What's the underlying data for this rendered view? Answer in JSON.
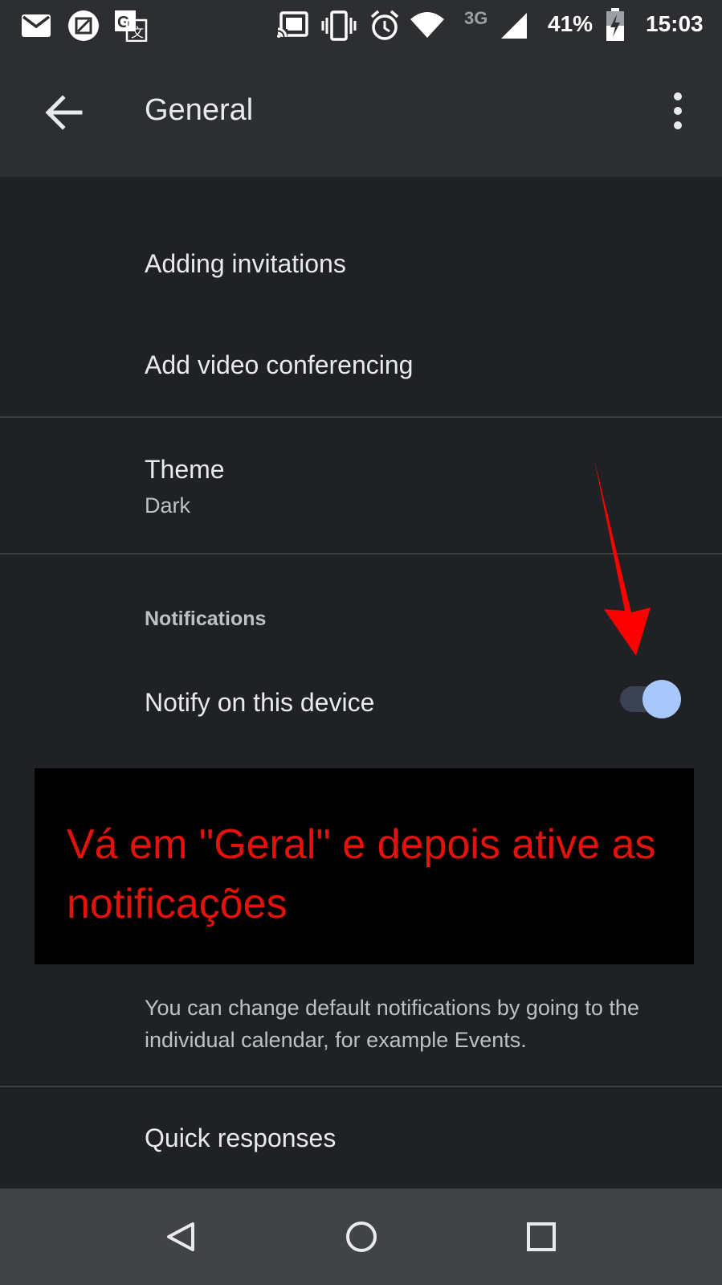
{
  "status_bar": {
    "network": "3G",
    "battery": "41%",
    "time": "15:03",
    "icons": [
      "mail-icon",
      "screenshot-icon",
      "translate-icon",
      "cast-icon",
      "vibrate-icon",
      "alarm-icon",
      "wifi-icon",
      "signal-icon",
      "battery-charging-icon"
    ]
  },
  "app_bar": {
    "title": "General",
    "back_icon": "arrow-back-icon",
    "menu_icon": "more-vert-icon"
  },
  "settings": {
    "adding_invitations": "Adding invitations",
    "add_video_conferencing": "Add video conferencing",
    "theme_label": "Theme",
    "theme_value": "Dark",
    "notifications_header": "Notifications",
    "notify_label": "Notify on this device",
    "notify_enabled": true,
    "helper_text": "You can change default notifications by going to the individual calendar, for example Events.",
    "quick_responses": "Quick responses"
  },
  "annotation": {
    "text": "Vá em \"Geral\" e depois ative as notificações",
    "color": "#e3120b",
    "arrow_color": "#ff0000"
  },
  "nav_bar": {
    "icons": [
      "nav-back-icon",
      "nav-home-icon",
      "nav-recents-icon"
    ]
  },
  "colors": {
    "background": "#202124",
    "app_bar": "#2d2e31",
    "toggle_thumb": "#a8c7fa",
    "toggle_track": "#3b4352"
  }
}
